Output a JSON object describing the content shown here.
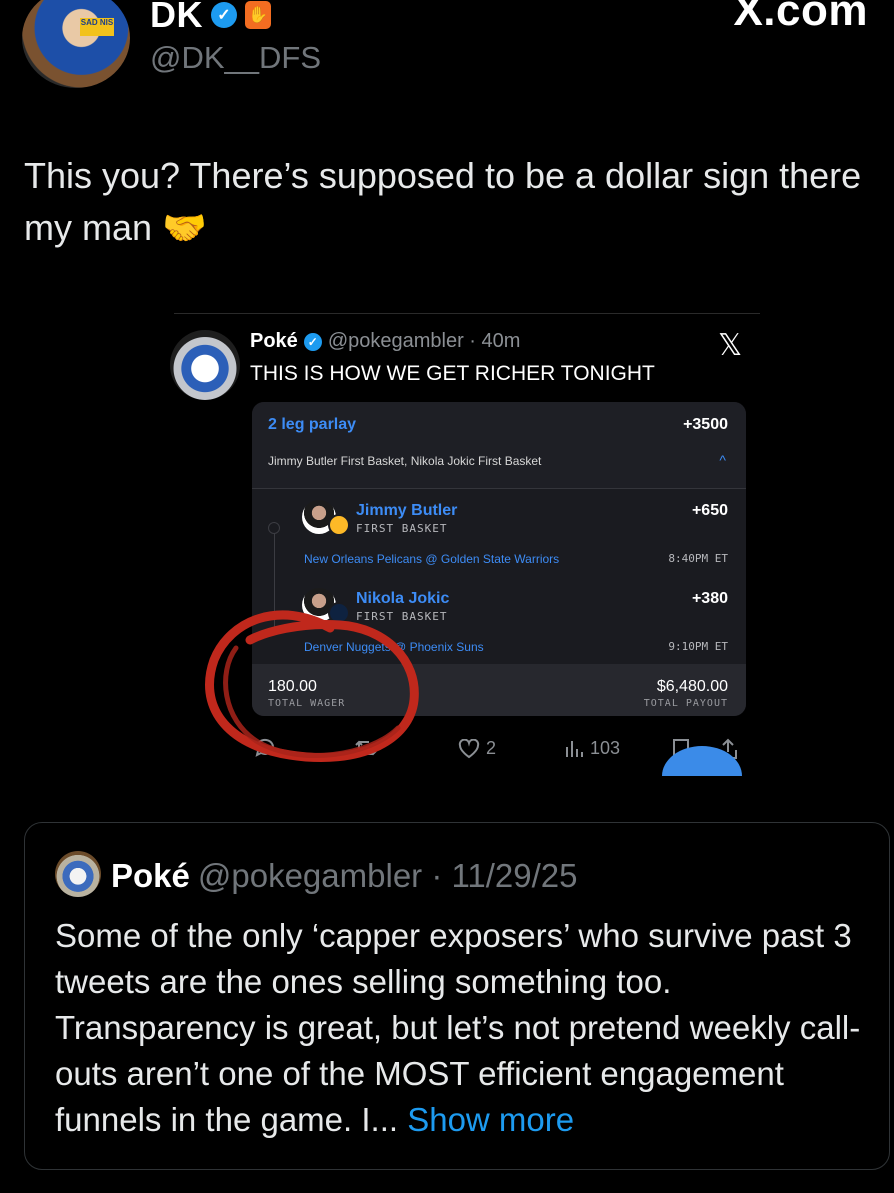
{
  "header": {
    "name": "DK",
    "handle": "@DK__DFS",
    "watermark": "X.com",
    "verified_icon": "verified-badge-icon",
    "affiliate_icon": "draftkings-logo-icon"
  },
  "tweet": {
    "text": "This you? There’s supposed to be a dollar sign there my man 🤝"
  },
  "embed": {
    "name": "Poké",
    "handle": "@pokegambler · 40m",
    "x_logo": "𝕏",
    "text": "THIS IS HOW WE GET RICHER TONIGHT",
    "slip": {
      "title": "2 leg parlay",
      "odds": "+3500",
      "summary": "Jimmy Butler First Basket, Nikola Jokic First Basket",
      "chevron": "^",
      "legs": [
        {
          "player": "Jimmy Butler",
          "market": "FIRST BASKET",
          "odds": "+650",
          "game": "New Orleans Pelicans @ Golden State Warriors",
          "time": "8:40PM ET"
        },
        {
          "player": "Nikola Jokic",
          "market": "FIRST BASKET",
          "odds": "+380",
          "game": "Denver Nuggets @ Phoenix Suns",
          "time": "9:10PM ET"
        }
      ],
      "wager": "180.00",
      "wager_label": "TOTAL WAGER",
      "payout": "$6,480.00",
      "payout_label": "TOTAL PAYOUT"
    },
    "actions": {
      "likes": "2",
      "views": "103"
    }
  },
  "quote": {
    "name": "Poké",
    "handle": "@pokegambler · 11/29/25",
    "text": "Some of the only ‘capper exposers’ who survive past 3 tweets are the ones selling something too. Transparency is great, but let’s not pretend weekly call-outs aren’t one of the MOST efficient engagement funnels in the game. I...",
    "show_more": "Show more"
  },
  "colors": {
    "accent_blue": "#1d9bf0",
    "annotation_red": "#c0281c",
    "background": "#000000"
  }
}
